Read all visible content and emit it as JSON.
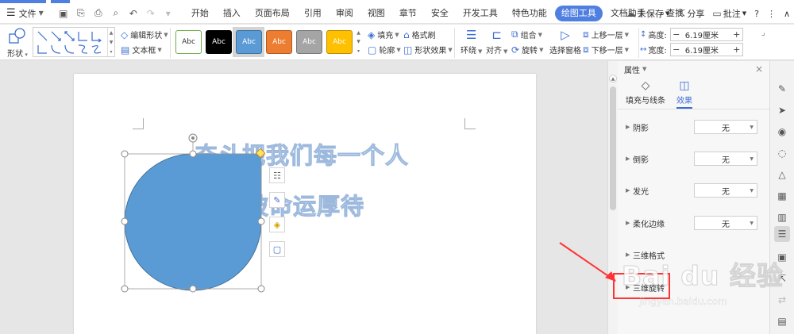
{
  "menubar": {
    "file_label": "文件",
    "tabs": [
      {
        "label": "开始"
      },
      {
        "label": "插入"
      },
      {
        "label": "页面布局"
      },
      {
        "label": "引用"
      },
      {
        "label": "审阅"
      },
      {
        "label": "视图"
      },
      {
        "label": "章节"
      },
      {
        "label": "安全"
      },
      {
        "label": "开发工具"
      },
      {
        "label": "特色功能"
      },
      {
        "label": "绘图工具"
      },
      {
        "label": "文档助手"
      }
    ],
    "search_label": "查找",
    "unsaved_label": "未保存",
    "share_label": "分享",
    "comment_label": "批注",
    "help_label": "?",
    "more_label": "⋮",
    "collapse_label": "∧"
  },
  "ribbon": {
    "shape_label": "形状",
    "edit_shape_label": "编辑形状",
    "textbox_label": "文本框",
    "style_swatches": [
      {
        "label": "Abc",
        "bg": "#ffffff",
        "fg": "#333333",
        "border": "#70ad47"
      },
      {
        "label": "Abc",
        "bg": "#000000",
        "fg": "#ffffff",
        "border": "#000000"
      },
      {
        "label": "Abc",
        "bg": "#5b9bd5",
        "fg": "#ffffff",
        "border": "#41719c"
      },
      {
        "label": "Abc",
        "bg": "#ed7d31",
        "fg": "#ffffff",
        "border": "#ae5a21"
      },
      {
        "label": "Abc",
        "bg": "#a5a5a5",
        "fg": "#ffffff",
        "border": "#787878"
      },
      {
        "label": "Abc",
        "bg": "#ffc000",
        "fg": "#ffffff",
        "border": "#bc8c00"
      }
    ],
    "fill_label": "填充",
    "format_brush_label": "格式刷",
    "outline_label": "轮廓",
    "shape_effect_label": "形状效果",
    "wrap_label": "环绕",
    "align_label": "对齐",
    "group_label": "组合",
    "rotate_label": "旋转",
    "select_pane_label": "选择窗格",
    "bring_forward_label": "上移一层",
    "send_backward_label": "下移一层",
    "height_label": "高度:",
    "height_value": "6.19厘米",
    "width_label": "宽度:",
    "width_value": "6.19厘米"
  },
  "document": {
    "text_line1": "奋斗把我们每一个人",
    "text_line2": "被命运厚待",
    "shape_fill": "#5b9bd5"
  },
  "panel": {
    "title": "属性",
    "tab_fill": "填充与线条",
    "tab_effect": "效果",
    "rows": [
      {
        "label": "阴影",
        "value": "无"
      },
      {
        "label": "倒影",
        "value": "无"
      },
      {
        "label": "发光",
        "value": "无"
      },
      {
        "label": "柔化边缘",
        "value": "无"
      },
      {
        "label": "三维格式",
        "value": ""
      },
      {
        "label": "三维旋转",
        "value": ""
      }
    ]
  },
  "watermark": {
    "main": "Bai du 经验",
    "sub": "jingyan.baidu.com"
  },
  "colors": {
    "accent": "#4f7fe0",
    "ribbon_icon": "#3c6fd1",
    "annotation": "#ff3333"
  }
}
